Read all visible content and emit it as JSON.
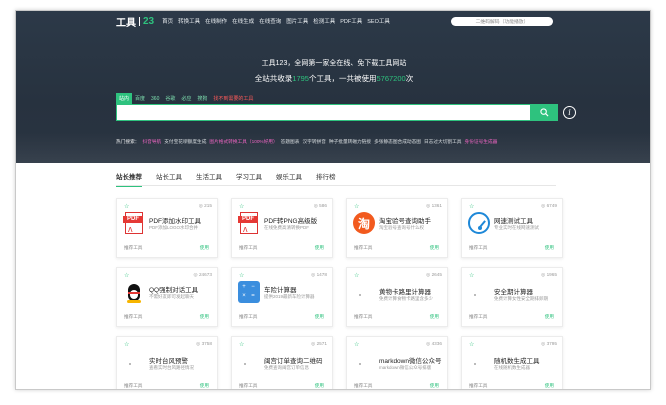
{
  "nav": {
    "logo_text": "工具",
    "logo_num": "23",
    "links": [
      "首页",
      "转换工具",
      "在线制作",
      "在线生成",
      "在线查询",
      "图片工具",
      "检测工具",
      "PDF工具",
      "SEO工具"
    ],
    "search_placeholder": "二维码解码（功能播放）"
  },
  "hero": {
    "tagline1": "工具123，全网第一家全在线、免下载工具网站",
    "tagline2_prefix": "全站共收录",
    "tools_count": "1795",
    "tagline2_mid": "个工具，一共被使用",
    "uses_count": "5767200",
    "tagline2_suffix": "次",
    "search_tabs": [
      {
        "label": "站内",
        "active": true,
        "red": false
      },
      {
        "label": "百度",
        "active": false,
        "red": false
      },
      {
        "label": "360",
        "active": false,
        "red": false
      },
      {
        "label": "谷歌",
        "active": false,
        "red": false
      },
      {
        "label": "必应",
        "active": false,
        "red": false
      },
      {
        "label": "搜狗",
        "active": false,
        "red": false
      },
      {
        "label": "找不到需要的工具",
        "active": false,
        "red": true
      }
    ],
    "hot_label": "热门搜索：",
    "hot_items": [
      {
        "text": "抖音导航",
        "tone": "m"
      },
      {
        "text": "支付宝花呗额度生成",
        "tone": "w"
      },
      {
        "text": "图片格式转换工具（100%好用）",
        "tone": "m"
      },
      {
        "text": "答题图表",
        "tone": "w"
      },
      {
        "text": "汉字转拼音",
        "tone": "w"
      },
      {
        "text": "种子批量转磁力链接",
        "tone": "w"
      },
      {
        "text": "多张静态图合成动态图",
        "tone": "w"
      },
      {
        "text": "日志过大切割工具",
        "tone": "w"
      },
      {
        "text": "身份证号生成器",
        "tone": "m"
      }
    ]
  },
  "categories": [
    {
      "label": "站长推荐",
      "active": true
    },
    {
      "label": "站长工具",
      "active": false
    },
    {
      "label": "生活工具",
      "active": false
    },
    {
      "label": "学习工具",
      "active": false
    },
    {
      "label": "娱乐工具",
      "active": false
    },
    {
      "label": "排行榜",
      "active": false
    }
  ],
  "cards": [
    {
      "name": "PDF添加水印工具",
      "desc": "PDF添加LOGO水印合并",
      "views": "215",
      "icon": "pdf"
    },
    {
      "name": "PDF转PNG高级版",
      "desc": "在线免费高清转换PDF",
      "views": "586",
      "icon": "pdf"
    },
    {
      "name": "淘宝验号查询助手",
      "desc": "淘宝验号查询号什么权",
      "views": "1361",
      "icon": "taobao"
    },
    {
      "name": "网速测试工具",
      "desc": "专业实时在线网速测试",
      "views": "6749",
      "icon": "speed"
    },
    {
      "name": "QQ强制对话工具",
      "desc": "不需好友即可发起聊天",
      "views": "24673",
      "icon": "qq"
    },
    {
      "name": "车险计算器",
      "desc": "提供2019最新车险计算器",
      "views": "1478",
      "icon": "calc"
    },
    {
      "name": "黄物卡路里计算器",
      "desc": "免费计算食物卡路里含多少",
      "views": "2645",
      "icon": "none"
    },
    {
      "name": "安全期计算器",
      "desc": "免费计算女性安全期排卵期",
      "views": "1965",
      "icon": "none"
    },
    {
      "name": "实时台风预警",
      "desc": "查看实时台风路径情况",
      "views": "3758",
      "icon": "none"
    },
    {
      "name": "闽宫订单查询二维码",
      "desc": "免费查询闽宫订单信息",
      "views": "2571",
      "icon": "none"
    },
    {
      "name": "markdown微信公众号",
      "desc": "markdown微信公众号排版",
      "views": "4336",
      "icon": "none"
    },
    {
      "name": "随机数生成工具",
      "desc": "在线随机数生成器",
      "views": "3795",
      "icon": "none"
    }
  ],
  "card_common": {
    "foot": "推荐工具",
    "use": "使用",
    "star": "☆",
    "view_glyph": "◎"
  },
  "icons": {
    "search": "search-icon",
    "info": "info-icon"
  },
  "colors": {
    "accent": "#2ec27e",
    "hero_bg": "#2c3948",
    "hot_highlight": "#ff66cc",
    "warning_text": "#ff5a5a"
  }
}
